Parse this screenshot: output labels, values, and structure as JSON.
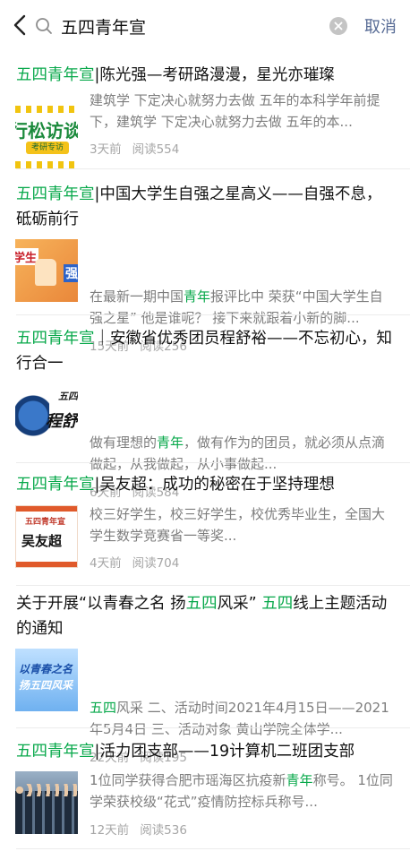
{
  "search": {
    "query": "五四青年宣",
    "cancel_label": "取消"
  },
  "colors": {
    "highlight": "#07a84a",
    "link": "#576b95",
    "meta": "#a6a6a6",
    "snippet": "#7d7d7d"
  },
  "icons": {
    "back": "chevron-left-icon",
    "search": "search-icon",
    "clear": "clear-icon"
  },
  "results": [
    {
      "title_parts": [
        {
          "text": "五四青年宣",
          "hl": true
        },
        {
          "text": "|陈光强—考研路漫漫，星光亦璀璨",
          "hl": false
        }
      ],
      "snippet_parts": [
        {
          "text": "建筑学 下定决心就努力去做 五年的本科学年前提下，建筑学 下定决心就努力去做 五年的本...",
          "hl": false
        }
      ],
      "time": "3天前",
      "reads": "阅读554",
      "thumb_texts": [
        "行松访谈",
        "考研专访"
      ]
    },
    {
      "title_parts": [
        {
          "text": "五四青年宣",
          "hl": true
        },
        {
          "text": "|中国大学生自强之星高义——自强不息，砥砺前行",
          "hl": false
        }
      ],
      "snippet_parts": [
        {
          "text": "在最新一期中国",
          "hl": false
        },
        {
          "text": "青年",
          "hl": true
        },
        {
          "text": "报评比中 荣获“中国大学生自强之星” 他是谁呢？ 接下来就跟着小新的脚...",
          "hl": false
        }
      ],
      "time": "15天前",
      "reads": "阅读256",
      "thumb_texts": [
        "学生",
        "强"
      ]
    },
    {
      "title_parts": [
        {
          "text": "五四青年宣",
          "hl": true
        },
        {
          "text": "｜安徽省优秀团员程舒裕——不忘初心，知行合一",
          "hl": false
        }
      ],
      "snippet_parts": [
        {
          "text": "做有理想的",
          "hl": false
        },
        {
          "text": "青年",
          "hl": true
        },
        {
          "text": "，做有作为的团员，就必须从点滴做起，从我做起，从小事做起...",
          "hl": false
        }
      ],
      "time": "6天前",
      "reads": "阅读584",
      "thumb_texts": [
        "五四",
        "程舒"
      ]
    },
    {
      "title_parts": [
        {
          "text": "五四青年宣",
          "hl": true
        },
        {
          "text": "|吴友超：成功的秘密在于坚持理想",
          "hl": false
        }
      ],
      "snippet_parts": [
        {
          "text": "校三好学生，校三好学生，校优秀毕业生，全国大学生数学竞赛省一等奖...",
          "hl": false
        }
      ],
      "time": "4天前",
      "reads": "阅读704",
      "thumb_texts": [
        "五四青年宣",
        "吴友超"
      ]
    },
    {
      "title_parts": [
        {
          "text": "关于开展“以青春之名 扬",
          "hl": false
        },
        {
          "text": "五四",
          "hl": true
        },
        {
          "text": "风采” ",
          "hl": false
        },
        {
          "text": "五四",
          "hl": true
        },
        {
          "text": "线上主题活动的通知",
          "hl": false
        }
      ],
      "snippet_parts": [
        {
          "text": "五四",
          "hl": true
        },
        {
          "text": "风采 二、活动时间2021年4月15日——2021年5月4日 三、活动对象 黄山学院全体学...",
          "hl": false
        }
      ],
      "time": "22天前",
      "reads": "阅读195",
      "thumb_texts": [
        "以青春之名",
        "扬五四风采"
      ]
    },
    {
      "title_parts": [
        {
          "text": "五四青年宣",
          "hl": true
        },
        {
          "text": "|活力团支部——19计算机二班团支部",
          "hl": false
        }
      ],
      "snippet_parts": [
        {
          "text": "1位同学获得合肥市瑶海区抗疫新",
          "hl": false
        },
        {
          "text": "青年",
          "hl": true
        },
        {
          "text": "称号。 1位同学荣获校级“花式”疫情防控标兵称号...",
          "hl": false
        }
      ],
      "time": "12天前",
      "reads": "阅读536",
      "thumb_texts": []
    }
  ]
}
